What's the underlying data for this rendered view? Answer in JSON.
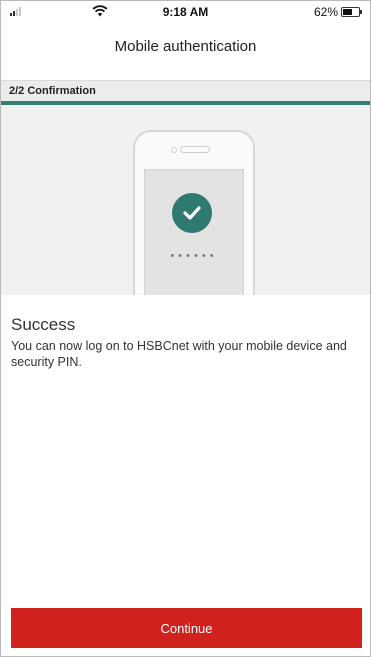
{
  "status_bar": {
    "time": "9:18 AM",
    "battery_percent": "62%",
    "battery_level": 0.62,
    "signal_icon": "cellular-signal-icon",
    "wifi_icon": "wifi-icon",
    "battery_icon": "battery-icon"
  },
  "header": {
    "title": "Mobile authentication"
  },
  "step": {
    "label": "2/2 Confirmation",
    "accent_color": "#2f7f72"
  },
  "illustration": {
    "icon": "checkmark-icon",
    "pin_dots": "••••••",
    "check_color": "#2e7a70"
  },
  "content": {
    "title": "Success",
    "message": "You can now log on to HSBCnet with your mobile device and security PIN."
  },
  "actions": {
    "continue_label": "Continue",
    "continue_color": "#d0211d"
  }
}
